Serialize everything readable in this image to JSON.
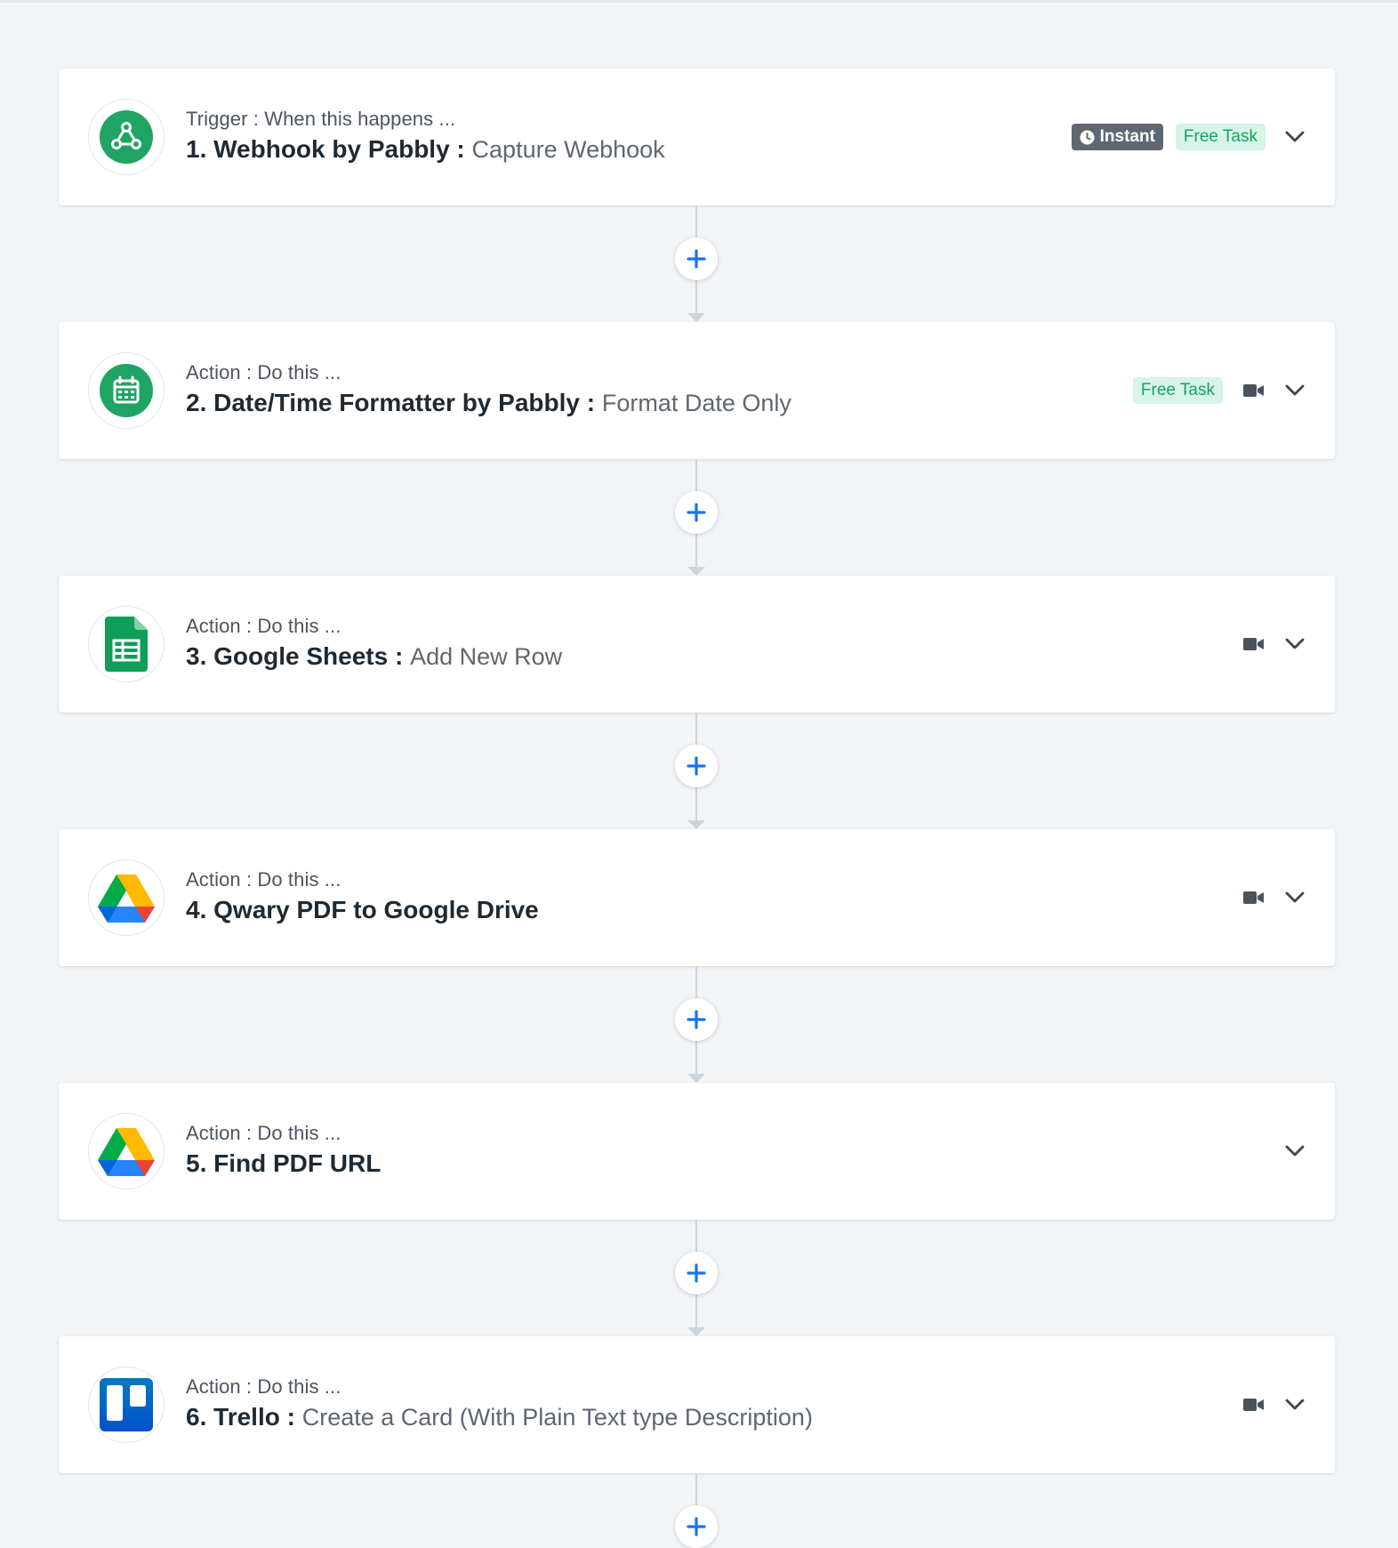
{
  "colors": {
    "accent_blue": "#1a73e8",
    "instant_badge_bg": "#5f6870",
    "free_task_bg": "#d6f5e7",
    "free_task_text": "#18a35f",
    "pabbly_green": "#1fa463"
  },
  "steps": [
    {
      "kind": "Trigger : When this happens ...",
      "app": "1. Webhook by Pabbly",
      "separator": " : ",
      "event": "Capture Webhook",
      "icon": "webhook-icon",
      "instant_label": "Instant",
      "free_task_label": "Free Task"
    },
    {
      "kind": "Action : Do this ...",
      "app": "2. Date/Time Formatter by Pabbly",
      "separator": " : ",
      "event": "Format Date Only",
      "icon": "calendar-icon",
      "free_task_label": "Free Task"
    },
    {
      "kind": "Action : Do this ...",
      "app": "3. Google Sheets",
      "separator": " : ",
      "event": "Add New Row",
      "icon": "google-sheets-icon"
    },
    {
      "kind": "Action : Do this ...",
      "app": "4. Qwary PDF to Google Drive",
      "icon": "google-drive-icon"
    },
    {
      "kind": "Action : Do this ...",
      "app": "5. Find PDF URL",
      "icon": "google-drive-icon"
    },
    {
      "kind": "Action : Do this ...",
      "app": "6. Trello",
      "separator": " : ",
      "event": "Create a Card (With Plain Text type Description)",
      "icon": "trello-icon"
    }
  ]
}
